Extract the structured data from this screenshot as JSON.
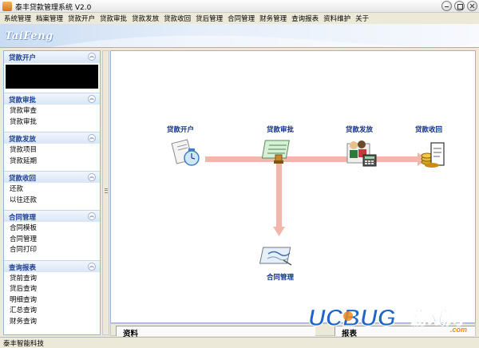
{
  "window": {
    "title": "泰丰贷款管理系统 V2.0"
  },
  "menu": [
    "系统管理",
    "档案管理",
    "贷款开户",
    "贷款审批",
    "贷款发放",
    "贷款收回",
    "贷后管理",
    "合同管理",
    "财务管理",
    "查询报表",
    "资料维护",
    "关于"
  ],
  "banner": {
    "logo": "TaiFeng"
  },
  "sidebar": {
    "sections": [
      {
        "title": "贷款开户",
        "items": []
      },
      {
        "title": "贷款审批",
        "items": [
          "贷款审查",
          "贷款审批"
        ]
      },
      {
        "title": "贷款发放",
        "items": [
          "贷款项目",
          "贷款延期"
        ]
      },
      {
        "title": "贷款收回",
        "items": [
          "还款",
          "以往还款"
        ]
      },
      {
        "title": "合同管理",
        "items": [
          "合同模板",
          "合同管理",
          "合同打印"
        ]
      },
      {
        "title": "查询报表",
        "items": [
          "贷前查询",
          "贷后查询",
          "明细查询",
          "汇总查询",
          "财务查询"
        ]
      }
    ]
  },
  "flow": {
    "steps": {
      "open": "贷款开户",
      "approve": "贷款审批",
      "issue": "贷款发放",
      "recover": "贷款收回",
      "contract": "合同管理"
    },
    "arrow_color": "#f2b6ad"
  },
  "bottom_tabs": {
    "left": "资料",
    "right": "报表"
  },
  "watermark": {
    "brand": "UCBUG",
    "cn": "游戏网",
    "url": ".com"
  },
  "status": {
    "text": "泰丰智能科技"
  },
  "colors": {
    "accent": "#1c3f94",
    "banner": "#c9dcf3",
    "watermark_blue": "#1f64c8",
    "watermark_orange": "#f08a1a"
  }
}
